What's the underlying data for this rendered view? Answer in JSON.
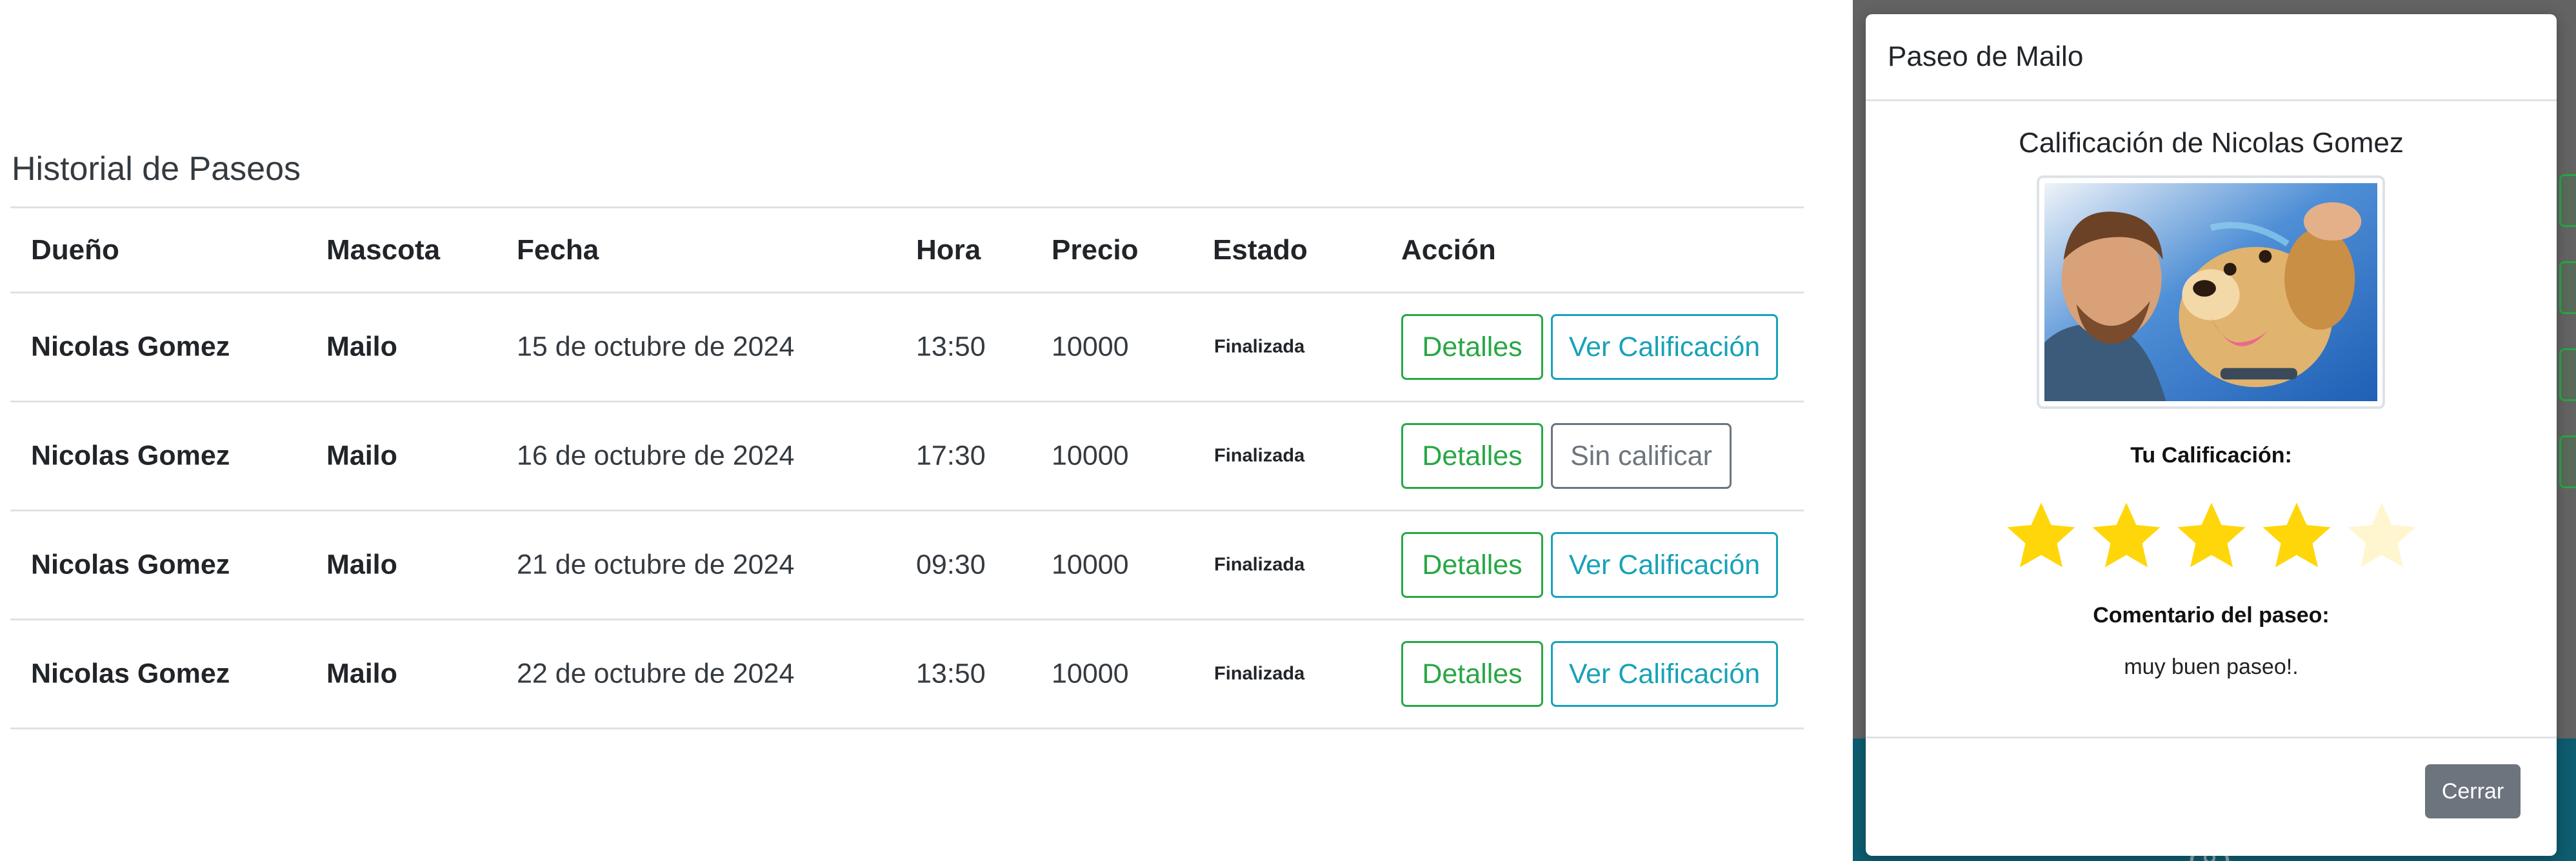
{
  "history": {
    "title": "Historial de Paseos",
    "columns": [
      "Dueño",
      "Mascota",
      "Fecha",
      "Hora",
      "Precio",
      "Estado",
      "Acción"
    ],
    "rows": [
      {
        "owner": "Nicolas Gomez",
        "pet": "Mailo",
        "date": "15 de octubre de 2024",
        "hour": "13:50",
        "price": "10000",
        "state": "Finalizada",
        "detail_label": "Detalles",
        "rating_label": "Ver Calificación",
        "rated": true
      },
      {
        "owner": "Nicolas Gomez",
        "pet": "Mailo",
        "date": "16 de octubre de 2024",
        "hour": "17:30",
        "price": "10000",
        "state": "Finalizada",
        "detail_label": "Detalles",
        "rating_label": "Sin calificar",
        "rated": false
      },
      {
        "owner": "Nicolas Gomez",
        "pet": "Mailo",
        "date": "21 de octubre de 2024",
        "hour": "09:30",
        "price": "10000",
        "state": "Finalizada",
        "detail_label": "Detalles",
        "rating_label": "Ver Calificación",
        "rated": true
      },
      {
        "owner": "Nicolas Gomez",
        "pet": "Mailo",
        "date": "22 de octubre de 2024",
        "hour": "13:50",
        "price": "10000",
        "state": "Finalizada",
        "detail_label": "Detalles",
        "rating_label": "Ver Calificación",
        "rated": true
      }
    ]
  },
  "modal": {
    "title": "Paseo de Mailo",
    "rating_heading": "Calificación de Nicolas Gomez",
    "photo_icon": "man-with-dog-photo",
    "your_rating_label": "Tu Calificación:",
    "rating": 4,
    "rating_max": 5,
    "comment_label": "Comentario del paseo:",
    "comment": "muy buen paseo!.",
    "close_label": "Cerrar"
  },
  "colors": {
    "success": "#28a745",
    "info": "#17a2b8",
    "secondary": "#6c757d",
    "star_filled": "#ffd60a",
    "star_empty": "#fff6cf",
    "footer_teal": "#0d5c6f"
  }
}
